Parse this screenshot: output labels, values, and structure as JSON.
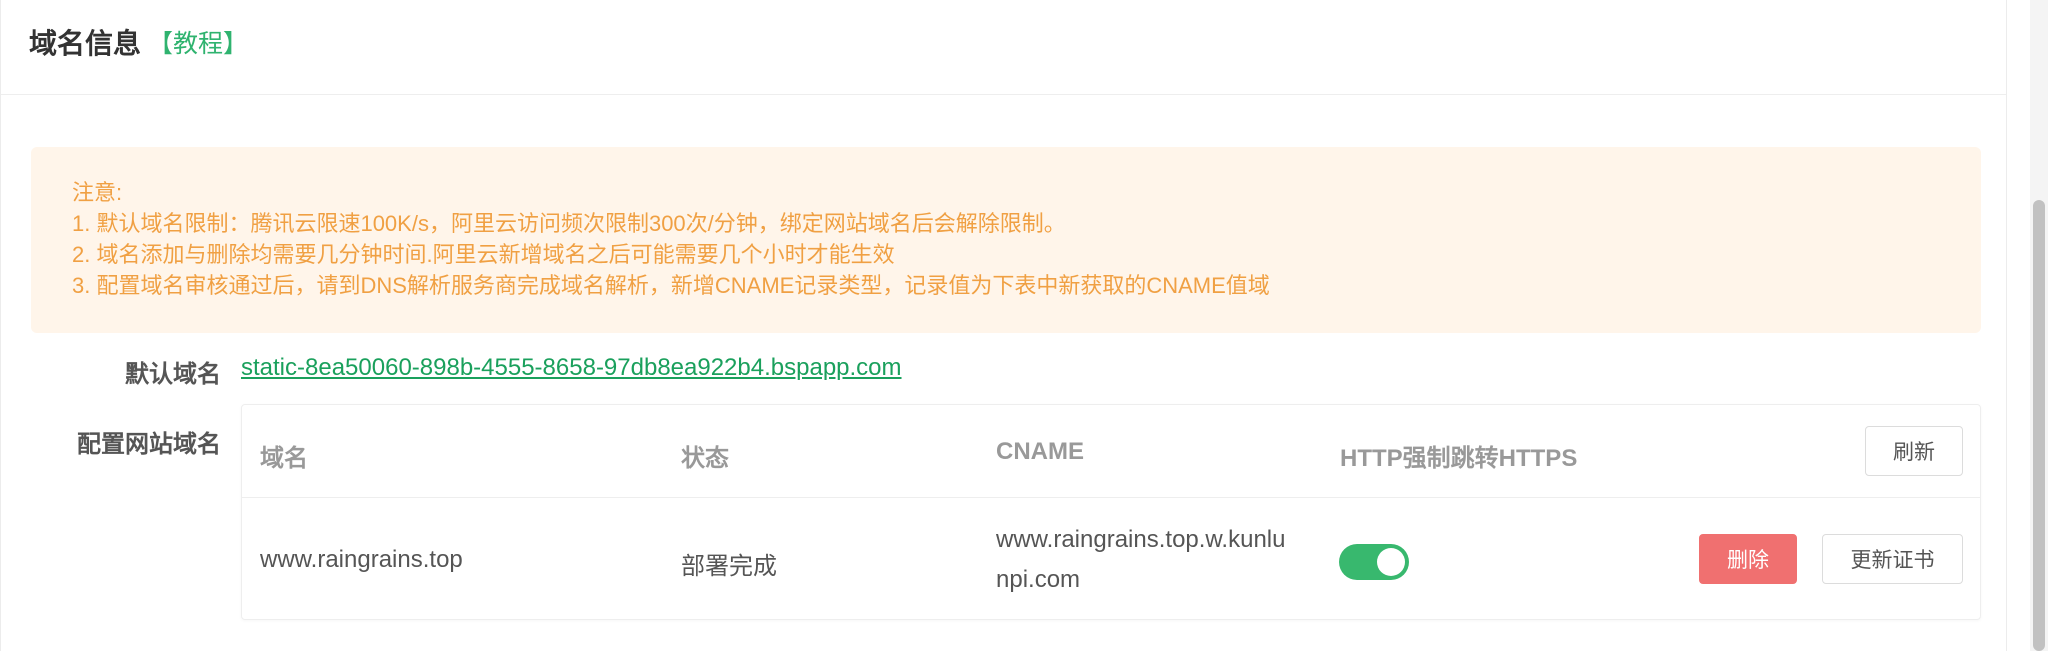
{
  "header": {
    "title": "域名信息",
    "tutorial_link": "【教程】"
  },
  "notice": {
    "heading": "注意:",
    "lines": [
      "1. 默认域名限制：腾讯云限速100K/s，阿里云访问频次限制300次/分钟，绑定网站域名后会解除限制。",
      "2. 域名添加与删除均需要几分钟时间.阿里云新增域名之后可能需要几个小时才能生效",
      "3. 配置域名审核通过后，请到DNS解析服务商完成域名解析，新增CNAME记录类型，记录值为下表中新获取的CNAME值域"
    ]
  },
  "default_domain": {
    "label": "默认域名",
    "value": "static-8ea50060-898b-4555-8658-97db8ea922b4.bspapp.com"
  },
  "config_domain": {
    "label": "配置网站域名",
    "columns": [
      "域名",
      "状态",
      "CNAME",
      "HTTP强制跳转HTTPS"
    ],
    "refresh_label": "刷新",
    "rows": [
      {
        "domain": "www.raingrains.top",
        "status": "部署完成",
        "cname_line1": "www.raingrains.top.w.kunlu",
        "cname_line2": "npi.com",
        "force_https": true,
        "delete_label": "删除",
        "renew_label": "更新证书"
      }
    ]
  },
  "colors": {
    "accent_green": "#2fb36f",
    "toggle_on": "#38b86e",
    "notice_bg": "#fff5ea",
    "notice_text": "#f0a043",
    "danger": "#f07070"
  }
}
